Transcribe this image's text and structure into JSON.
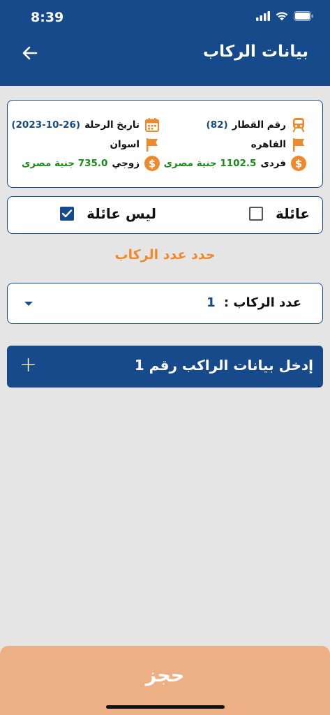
{
  "status_bar": {
    "time": "8:39"
  },
  "header": {
    "title": "بيانات الركاب",
    "back_icon": "arrow-left-icon"
  },
  "trip": {
    "train_label": "رقم القطار",
    "train_number": "(82)",
    "date_label": "تاريخ الرحلة",
    "date_value": "(2023-10-26)",
    "from_station": "القاهره",
    "to_station": "اسوان",
    "single_label": "فردى",
    "single_price": "1102.5 جنية مصرى",
    "double_label": "زوجي",
    "double_price": "735.0 جنية مصرى",
    "icons": {
      "train": "train-icon",
      "calendar": "calendar-icon",
      "flag": "flag-icon",
      "money": "dollar-circle-icon"
    },
    "colors": {
      "accent": "#ee8a2e",
      "primary": "#174a8a",
      "price": "#1a8a1a"
    }
  },
  "family": {
    "family_label": "عائلة",
    "family_checked": false,
    "not_family_label": "ليس عائلة",
    "not_family_checked": true
  },
  "passenger_count": {
    "section_label": "حدد عدد الركاب",
    "label": "عدد الركاب :",
    "value": "1"
  },
  "passenger_entry": {
    "label": "إدخل بيانات الراكب رقم 1",
    "icon": "plus-icon"
  },
  "book_button": {
    "label": "حجز"
  }
}
